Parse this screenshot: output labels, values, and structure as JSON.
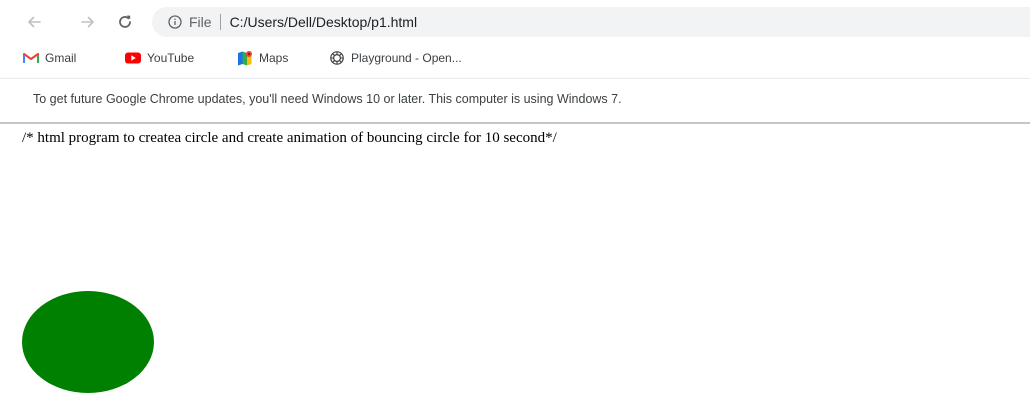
{
  "browser": {
    "address_bar": {
      "scheme_label": "File",
      "url": "C:/Users/Dell/Desktop/p1.html"
    },
    "bookmarks": [
      {
        "label": "Gmail",
        "icon": "gmail-icon"
      },
      {
        "label": "YouTube",
        "icon": "youtube-icon"
      },
      {
        "label": "Maps",
        "icon": "maps-icon"
      },
      {
        "label": "Playground - Open...",
        "icon": "openai-icon"
      }
    ],
    "infobar": {
      "message": "To get future Google Chrome updates, you'll need Windows 10 or later. This computer is using Windows 7."
    }
  },
  "page": {
    "comment_text": "/* html program to createa circle and create animation of bouncing circle for 10 second*/",
    "circle_color": "#008000"
  },
  "colors": {
    "toolbar_icon": "#9aa0a6",
    "reload_icon": "#5f6368",
    "omnibox_bg": "#f1f3f4",
    "youtube_red": "#ff0000",
    "gmail_red": "#ea4335"
  }
}
